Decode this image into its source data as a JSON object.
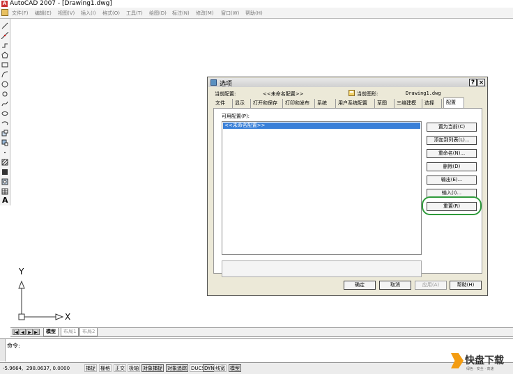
{
  "app": {
    "title": "AutoCAD 2007 - [Drawing1.dwg]"
  },
  "menu": [
    "文件(F)",
    "编辑(E)",
    "视图(V)",
    "插入(I)",
    "格式(O)",
    "工具(T)",
    "绘图(D)",
    "标注(N)",
    "修改(M)",
    "窗口(W)",
    "帮助(H)"
  ],
  "left_toolbar": {
    "icons": [
      "line-icon",
      "construction-line-icon",
      "polyline-icon",
      "polygon-icon",
      "rectangle-icon",
      "arc-icon",
      "circle-icon",
      "revcloud-icon",
      "spline-icon",
      "ellipse-icon",
      "ellipse-arc-icon",
      "insert-block-icon",
      "make-block-icon",
      "point-icon",
      "hatch-icon",
      "gradient-icon",
      "region-icon",
      "table-icon"
    ],
    "text_tool": "A"
  },
  "ucs": {
    "x_label": "X",
    "y_label": "Y"
  },
  "layout_tabs": [
    "模型",
    "布局1",
    "布局2"
  ],
  "nav_buttons": [
    "|◀",
    "◀",
    "▶",
    "▶|"
  ],
  "command_line": {
    "prompt": "命令:"
  },
  "status_bar": {
    "coords": "-5.9664,  298.0637, 0.0000",
    "toggles": [
      "捕捉",
      "栅格",
      "正交",
      "极轴",
      "对象捕捉",
      "对象追踪",
      "DUCS",
      "DYN",
      "线宽",
      "模型"
    ]
  },
  "dialog": {
    "title": "选项",
    "help_btn": "?",
    "close_btn": "×",
    "current_profile_label": "当前配置:",
    "current_profile_value": "<<未命名配置>>",
    "current_drawing_label": "当前图形:",
    "current_drawing_value": "Drawing1.dwg",
    "tabs": [
      "文件",
      "显示",
      "打开和保存",
      "打印和发布",
      "系统",
      "用户系统配置",
      "草图",
      "三维建模",
      "选择",
      "配置"
    ],
    "active_tab": "配置",
    "available_profiles_label": "可用配置(P):",
    "profiles": [
      "<<未命名配置>>"
    ],
    "buttons": {
      "set_current": "置为当前(C)",
      "add_to_list": "添加到列表(L)...",
      "rename": "重命名(N)...",
      "delete": "删除(D)",
      "export": "输出(E)...",
      "import": "输入(I)...",
      "reset": "重置(R)"
    },
    "footer": {
      "ok": "确定",
      "cancel": "取消",
      "apply": "应用(A)",
      "help": "帮助(H)"
    }
  },
  "watermark": {
    "title": "快盘下载",
    "slogan": "绿色 · 安全 · 高速"
  },
  "colors": {
    "selection": "#3a80d8",
    "highlight_ring": "#2e9a3a",
    "dialog_bg": "#ece9d8"
  }
}
